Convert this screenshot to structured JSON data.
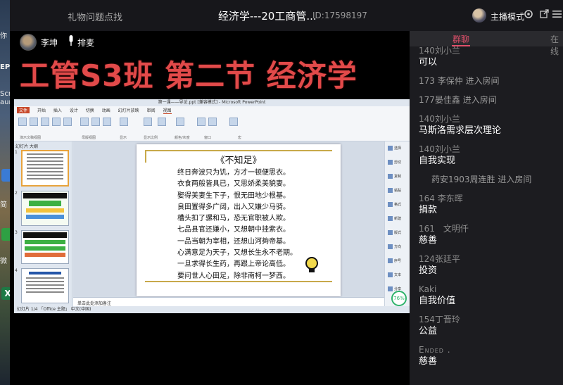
{
  "desktop": {
    "texts": [
      "你",
      "EP",
      "Scre",
      "aur",
      "简",
      "微"
    ],
    "icon_labels": [
      "X"
    ]
  },
  "window": {
    "left_label": "礼物问题点找",
    "title": "经济学---20工商管...",
    "room_id": "ID:17598197",
    "mode_label": "主播模式"
  },
  "stage": {
    "host_name": "李坤",
    "mic_label": "排麦",
    "banner": "工管S3班 第二节 经济学"
  },
  "ppt": {
    "window_title": "第一课——导论.ppt [兼容模式] - Microsoft PowerPoint",
    "tabs": [
      "文件",
      "开始",
      "插入",
      "设计",
      "切换",
      "动画",
      "幻灯片放映",
      "审阅",
      "视图"
    ],
    "ribbon_groups": [
      "演示文稿视图",
      "母版视图",
      "显示",
      "显示比例",
      "颜色/灰度",
      "窗口",
      "宏"
    ],
    "pane_tabs": "幻灯片  大纲",
    "slide_title": "《不知足》",
    "poem_lines": [
      "终日奔波只为饥，方才一顿便思衣。",
      "衣食两般皆具已，又思娇柔美貌妻。",
      "娶得美妻生下子，恨无田地少根基。",
      "良田置得多广阔，出入又嫌少马骑。",
      "槽头扣了骡和马，恐无官职被人欺。",
      "七品县官还嫌小，又想朝中挂紫衣。",
      "一品当朝为宰相，还想山河夠帝基。",
      "心满意足为天子，又想长生永不老期。",
      "一旦求得长生药，再跟上帝论高低。",
      "要问世人心田足，除非南柯一梦西。"
    ],
    "notes_placeholder": "单击此处添加备注",
    "right_items": [
      "选择",
      "剪切",
      "复制",
      "粘贴",
      "格式",
      "新建",
      "版式",
      "方向",
      "序号",
      "文本",
      "分享"
    ],
    "status_left": "幻灯片 1/4  「Office 主题」  中文(中国)",
    "zoom": "76%"
  },
  "chat": {
    "tabs": [
      "群聊",
      "在线"
    ],
    "messages": [
      {
        "kind": "msg",
        "name": "140刘小兰",
        "text": "可以"
      },
      {
        "kind": "sys",
        "text": "173 李保仲 进入房间"
      },
      {
        "kind": "sys",
        "text": "177晏佳鑫 进入房间"
      },
      {
        "kind": "msg",
        "name": "140刘小兰",
        "text": "马斯洛需求层次理论"
      },
      {
        "kind": "msg",
        "name": "140刘小兰",
        "text": "自我实现"
      },
      {
        "kind": "sys",
        "text": "药安1903周连胜 进入房间"
      },
      {
        "kind": "msg",
        "name": "164 李东晖",
        "text": "捐款"
      },
      {
        "kind": "msg",
        "name": "161　文明仟",
        "text": "慈善"
      },
      {
        "kind": "msg",
        "name": "124张廷平",
        "text": "投资"
      },
      {
        "kind": "msg",
        "name": "Kaki",
        "text": "自我价值"
      },
      {
        "kind": "msg",
        "name": "154丁晋玲",
        "text": "公益"
      },
      {
        "kind": "msg",
        "name": "Ended .",
        "text": "慈善"
      }
    ]
  },
  "colors": {
    "banner": "#e24a4a",
    "accent": "#e0506a",
    "chat_bg": "#1c1c20",
    "zoom_ring": "#2fb36b"
  }
}
